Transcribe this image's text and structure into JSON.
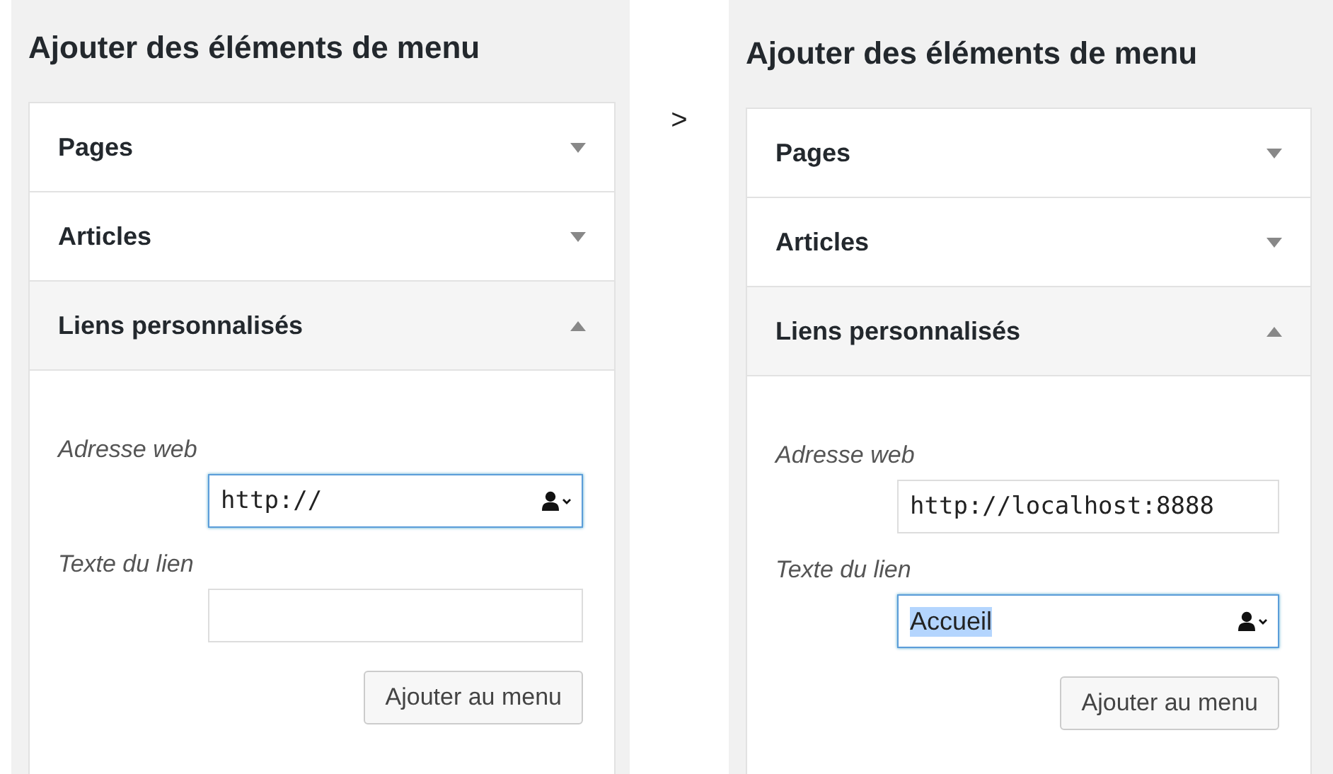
{
  "panels": [
    {
      "title": "Ajouter des éléments de menu",
      "sections": [
        {
          "label": "Pages",
          "expanded": false
        },
        {
          "label": "Articles",
          "expanded": false
        },
        {
          "label": "Liens personnalisés",
          "expanded": true
        }
      ],
      "fields": [
        {
          "label": "Adresse web",
          "kind": "url",
          "value": "http://",
          "focused": true,
          "highlighted": false
        },
        {
          "label": "Texte du lien",
          "kind": "text",
          "focused": false
        }
      ],
      "button": "Ajouter au menu"
    },
    {
      "title": "Ajouter des éléments de menu",
      "sections": [
        {
          "label": "Pages",
          "expanded": false
        },
        {
          "label": "Articles",
          "expanded": false
        },
        {
          "label": "Liens personnalisés",
          "expanded": true
        }
      ],
      "fields": [
        {
          "label": "Adresse web",
          "kind": "url",
          "value": "http://localhost:8888",
          "focused": false,
          "highlighted": false
        },
        {
          "label": "Texte du lien",
          "kind": "text",
          "value": "Accueil",
          "focused": true,
          "highlighted": true
        }
      ],
      "button": "Ajouter au menu"
    }
  ],
  "separator": ">"
}
